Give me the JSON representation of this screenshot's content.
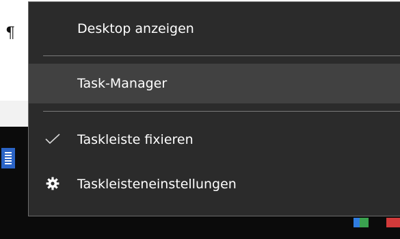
{
  "background": {
    "pilcrow": "¶"
  },
  "menu": {
    "items": [
      {
        "label": "Desktop anzeigen"
      },
      {
        "label": "Task-Manager"
      },
      {
        "label": "Taskleiste fixieren",
        "checked": true
      },
      {
        "label": "Taskleisteneinstellungen",
        "icon": "gear-icon"
      }
    ]
  },
  "colors": {
    "menu_bg": "#2b2b2b",
    "menu_hover": "#414141",
    "menu_text": "#ffffff",
    "separator": "#7a7a7a"
  }
}
